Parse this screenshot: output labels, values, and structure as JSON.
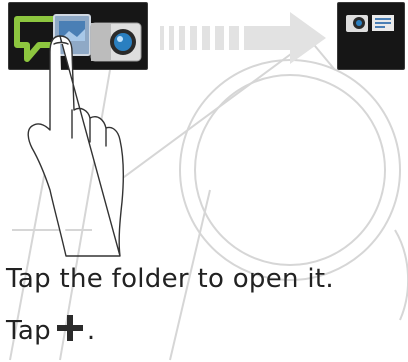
{
  "steps": [
    {
      "text": "Tap the folder to open it."
    },
    {
      "prefix": "Tap",
      "icon": "plus-icon",
      "suffix": "."
    }
  ],
  "colors": {
    "tile": "#161616",
    "accent_green": "#8dc63f",
    "text": "#222222"
  },
  "illustration": {
    "left_tile_icons": [
      "message-bubble-icon",
      "photo-icon",
      "camera-icon"
    ],
    "right_tile_icons": [
      "camera-icon",
      "message-icon"
    ],
    "arrow_icon": "right-arrow-icon",
    "hand_icon": "tapping-hand-icon"
  }
}
